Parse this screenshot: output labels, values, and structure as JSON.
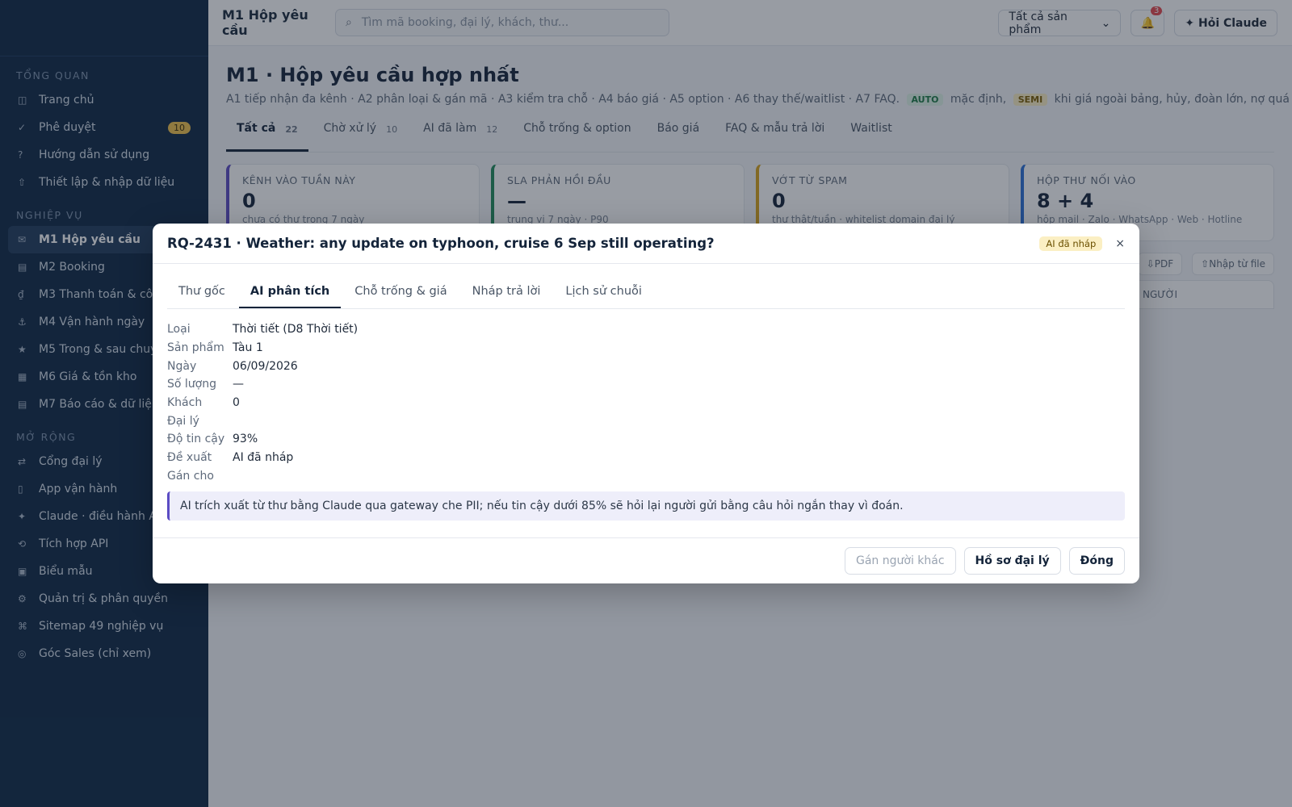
{
  "sidebar": {
    "sections": [
      "TỔNG QUAN",
      "NGHIỆP VỤ",
      "MỞ RỘNG"
    ],
    "overview": [
      {
        "icon": "◫",
        "label": "Trang chủ"
      },
      {
        "icon": "✓",
        "label": "Phê duyệt",
        "badge": "10"
      },
      {
        "icon": "?",
        "label": "Hướng dẫn sử dụng"
      },
      {
        "icon": "⇧",
        "label": "Thiết lập & nhập dữ liệu"
      }
    ],
    "business": [
      {
        "icon": "✉",
        "label": "M1 Hộp yêu cầu"
      },
      {
        "icon": "▤",
        "label": "M2 Booking"
      },
      {
        "icon": "₫",
        "label": "M3 Thanh toán & công nợ"
      },
      {
        "icon": "⚓",
        "label": "M4 Vận hành ngày"
      },
      {
        "icon": "★",
        "label": "M5 Trong & sau chuyến"
      },
      {
        "icon": "▦",
        "label": "M6 Giá & tồn kho"
      },
      {
        "icon": "▤",
        "label": "M7 Báo cáo & dữ liệu"
      }
    ],
    "extend": [
      {
        "icon": "⇄",
        "label": "Cổng đại lý"
      },
      {
        "icon": "▯",
        "label": "App vận hành"
      },
      {
        "icon": "✦",
        "label": "Claude · điều hành AI"
      },
      {
        "icon": "⟲",
        "label": "Tích hợp API"
      },
      {
        "icon": "▣",
        "label": "Biểu mẫu"
      },
      {
        "icon": "⚙",
        "label": "Quản trị & phân quyền"
      },
      {
        "icon": "⌘",
        "label": "Sitemap 49 nghiệp vụ"
      },
      {
        "icon": "◎",
        "label": "Góc Sales (chỉ xem)"
      }
    ]
  },
  "topbar": {
    "title": "M1 Hộp yêu cầu",
    "search_placeholder": "Tìm mã booking, đại lý, khách, thư...",
    "product_select": "Tất cả sản phẩm",
    "bell_count": "3",
    "ask_label": "✦ Hỏi Claude"
  },
  "main": {
    "title": "M1 · Hộp yêu cầu hợp nhất",
    "subtitle_a": "A1 tiếp nhận đa kênh · A2 phân loại & gán mã · A3 kiểm tra chỗ · A4 báo giá · A5 option · A6 thay thế/waitlist · A7 FAQ.",
    "tag_auto": "AUTO",
    "subtitle_b": "mặc định,",
    "tag_semi": "SEMI",
    "subtitle_c": "khi giá ngoài bảng, hủy, đoàn lớn, nợ quá hạn.",
    "tabs": [
      {
        "label": "Tất cả",
        "count": "22"
      },
      {
        "label": "Chờ xử lý",
        "count": "10"
      },
      {
        "label": "AI đã làm",
        "count": "12"
      },
      {
        "label": "Chỗ trống & option",
        "count": ""
      },
      {
        "label": "Báo giá",
        "count": ""
      },
      {
        "label": "FAQ & mẫu trả lời",
        "count": ""
      },
      {
        "label": "Waitlist",
        "count": ""
      }
    ],
    "stats": [
      {
        "label": "KÊNH VÀO TUẦN NÀY",
        "value": "0",
        "note": "chưa có thư trong 7 ngày",
        "color": "#5b4cc4"
      },
      {
        "label": "SLA PHẢN HỒI ĐẦU",
        "value": "—",
        "note": "trung vị 7 ngày · P90",
        "color": "#1f8a5a"
      },
      {
        "label": "VỚT TỪ SPAM",
        "value": "0",
        "note": "thư thật/tuần · whitelist domain đại lý",
        "color": "#d8a21a"
      },
      {
        "label": "HỘP THƯ NỐI VÀO",
        "value": "8 + 4",
        "note": "hộp mail · Zalo · WhatsApp · Web · Hotline",
        "color": "#2a6fd6"
      }
    ],
    "toolbar": [
      "⇩PDF",
      "⇧Nhập từ file"
    ],
    "table_head": "NGƯỜI",
    "faint_a": "lịch sử chuỗi",
    "faint_b": "AI đã làm 12"
  },
  "modal": {
    "title": "RQ-2431 · Weather: any update on typhoon, cruise 6 Sep still operating?",
    "status": "AI đã nháp",
    "close": "×",
    "tabs": [
      "Thư gốc",
      "AI phân tích",
      "Chỗ trống & giá",
      "Nháp trả lời",
      "Lịch sử chuỗi"
    ],
    "fields": [
      {
        "key": "Loại",
        "value": "Thời tiết (D8 Thời tiết)"
      },
      {
        "key": "Sản phẩm",
        "value": "Tàu 1"
      },
      {
        "key": "Ngày",
        "value": "06/09/2026"
      },
      {
        "key": "Số lượng",
        "value": "—"
      },
      {
        "key": "Khách",
        "value": "0"
      },
      {
        "key": "Đại lý",
        "value": ""
      },
      {
        "key": "Độ tin cậy",
        "value": "93%"
      },
      {
        "key": "Đề xuất",
        "value": "AI đã nháp"
      },
      {
        "key": "Gán cho",
        "value": ""
      }
    ],
    "note": "AI trích xuất từ thư bằng Claude qua gateway che PII; nếu tin cậy dưới 85% sẽ hỏi lại người gửi bằng câu hỏi ngắn thay vì đoán.",
    "buttons": {
      "assign": "Gán người khác",
      "agent": "Hồ sơ đại lý",
      "close": "Đóng"
    }
  }
}
